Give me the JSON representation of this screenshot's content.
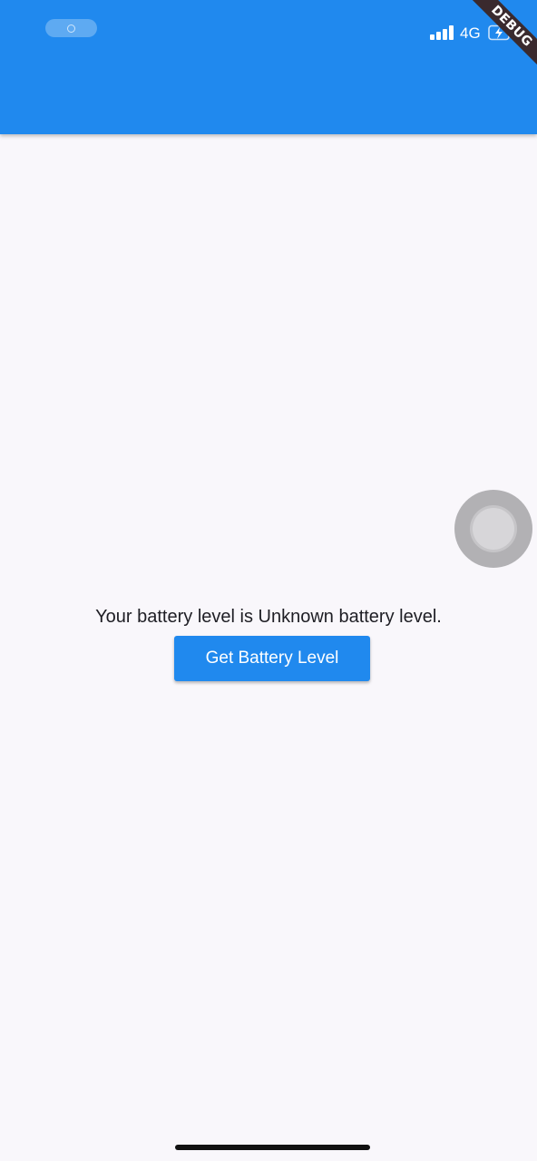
{
  "status_bar": {
    "network": "4G",
    "signal_icon": "signal-bars-icon",
    "battery_icon": "battery-charging-icon"
  },
  "debug_banner": {
    "label": "DEBUG"
  },
  "main": {
    "battery_message": "Your battery level is Unknown battery level.",
    "button_label": "Get Battery Level"
  },
  "colors": {
    "app_bar": "#2089ee",
    "button": "#2089ee",
    "background": "#f9f7fb"
  }
}
